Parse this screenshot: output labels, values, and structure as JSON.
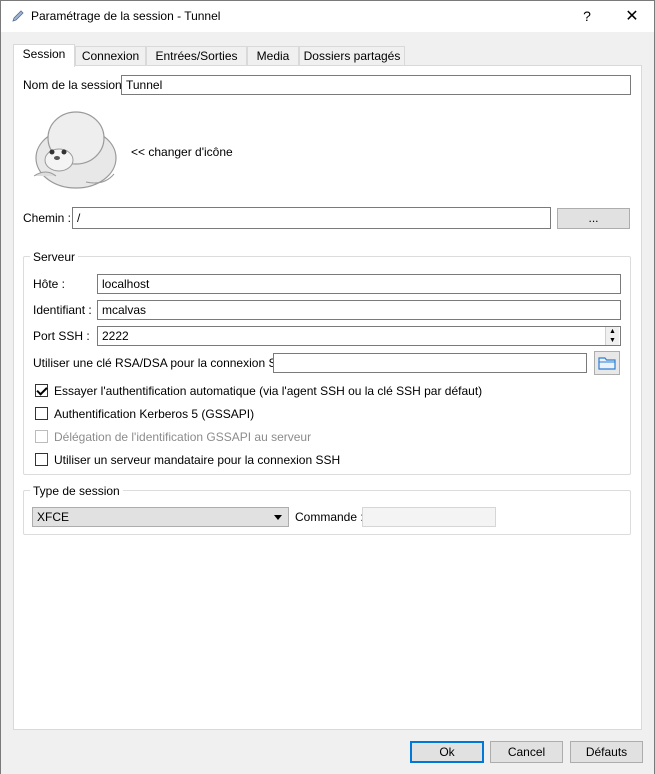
{
  "window": {
    "title": "Paramétrage de la session - Tunnel",
    "help_label": "?",
    "close_label": "✕"
  },
  "tabs": [
    {
      "label": "Session",
      "active": true
    },
    {
      "label": "Connexion",
      "active": false
    },
    {
      "label": "Entrées/Sorties",
      "active": false
    },
    {
      "label": "Media",
      "active": false
    },
    {
      "label": "Dossiers partagés",
      "active": false
    }
  ],
  "session": {
    "name_label": "Nom de la session :",
    "name_value": "Tunnel",
    "change_icon_label": "<< changer d'icône",
    "path_label": "Chemin :",
    "path_value": "/",
    "browse_label": "..."
  },
  "server": {
    "group_title": "Serveur",
    "host_label": "Hôte :",
    "host_value": "localhost",
    "login_label": "Identifiant :",
    "login_value": "mcalvas",
    "port_label": "Port SSH :",
    "port_value": "2222",
    "key_label": "Utiliser une clé RSA/DSA pour la connexion SSH :",
    "key_value": "",
    "auto_auth_label": "Essayer l'authentification automatique (via l'agent SSH ou la clé SSH par défaut)",
    "auto_auth_checked": true,
    "kerberos_label": "Authentification Kerberos 5 (GSSAPI)",
    "kerberos_checked": false,
    "delegation_label": "Délégation de l'identification GSSAPI au serveur",
    "delegation_checked": false,
    "proxy_label": "Utiliser un serveur mandataire pour la connexion SSH",
    "proxy_checked": false
  },
  "session_type": {
    "group_title": "Type de session",
    "selected": "XFCE",
    "command_label": "Commande :",
    "command_value": ""
  },
  "footer": {
    "ok_label": "Ok",
    "cancel_label": "Cancel",
    "defaults_label": "Défauts"
  },
  "colors": {
    "accent": "#0078d7",
    "folder_icon": "#2f7fd1"
  }
}
